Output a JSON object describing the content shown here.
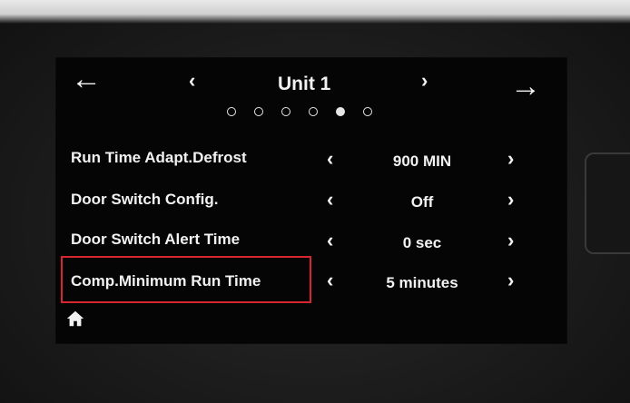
{
  "header": {
    "title": "Unit 1",
    "back_icon": "arrow-left-icon",
    "forward_icon": "arrow-right-icon",
    "prev_icon": "chevron-left-icon",
    "next_icon": "chevron-right-icon"
  },
  "pager": {
    "total": 6,
    "active_index": 5
  },
  "settings": [
    {
      "label": "Run Time Adapt.Defrost",
      "value": "900 MIN"
    },
    {
      "label": "Door Switch Config.",
      "value": "Off"
    },
    {
      "label": "Door Switch Alert Time",
      "value": "0 sec"
    },
    {
      "label": "Comp.Minimum Run Time",
      "value": "5 minutes"
    }
  ],
  "footer": {
    "home_icon": "home-icon"
  },
  "colors": {
    "screen_bg": "#050505",
    "text": "#f2f2f2",
    "highlight": "#d8262e"
  }
}
